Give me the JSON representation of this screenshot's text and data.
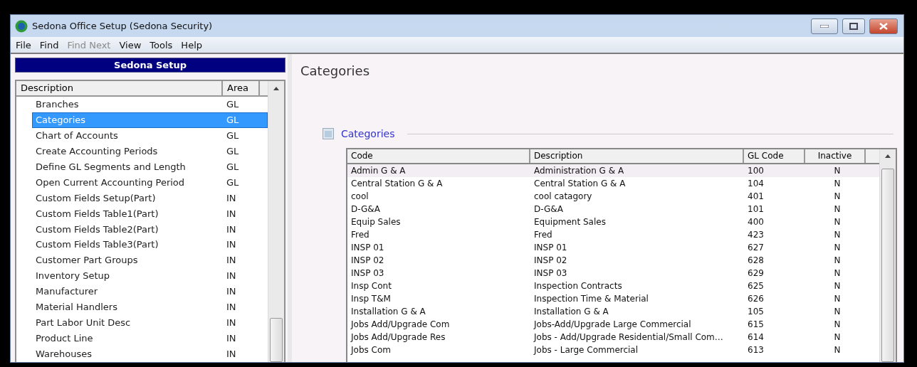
{
  "window": {
    "title": "Sedona Office Setup (Sedona Security)"
  },
  "menu": [
    {
      "label": "File",
      "disabled": false
    },
    {
      "label": "Find",
      "disabled": false
    },
    {
      "label": "Find Next",
      "disabled": true
    },
    {
      "label": "View",
      "disabled": false
    },
    {
      "label": "Tools",
      "disabled": false
    },
    {
      "label": "Help",
      "disabled": false
    }
  ],
  "sidebar": {
    "title": "Sedona Setup",
    "columns": [
      "Description",
      "Area"
    ],
    "items": [
      {
        "description": "Branches",
        "area": "GL",
        "selected": false
      },
      {
        "description": "Categories",
        "area": "GL",
        "selected": true
      },
      {
        "description": "Chart of Accounts",
        "area": "GL",
        "selected": false
      },
      {
        "description": "Create Accounting Periods",
        "area": "GL",
        "selected": false
      },
      {
        "description": "Define GL Segments and Length",
        "area": "GL",
        "selected": false
      },
      {
        "description": "Open Current Accounting Period",
        "area": "GL",
        "selected": false
      },
      {
        "description": "Custom Fields Setup(Part)",
        "area": "IN",
        "selected": false
      },
      {
        "description": "Custom Fields Table1(Part)",
        "area": "IN",
        "selected": false
      },
      {
        "description": "Custom Fields Table2(Part)",
        "area": "IN",
        "selected": false
      },
      {
        "description": "Custom Fields Table3(Part)",
        "area": "IN",
        "selected": false
      },
      {
        "description": "Customer Part Groups",
        "area": "IN",
        "selected": false
      },
      {
        "description": "Inventory Setup",
        "area": "IN",
        "selected": false
      },
      {
        "description": "Manufacturer",
        "area": "IN",
        "selected": false
      },
      {
        "description": "Material Handlers",
        "area": "IN",
        "selected": false
      },
      {
        "description": "Part Labor Unit Desc",
        "area": "IN",
        "selected": false
      },
      {
        "description": "Product Line",
        "area": "IN",
        "selected": false
      },
      {
        "description": "Warehouses",
        "area": "IN",
        "selected": false
      }
    ]
  },
  "content": {
    "title": "Categories",
    "group_title": "Categories",
    "table": {
      "columns": [
        "Code",
        "Description",
        "GL Code",
        "Inactive"
      ],
      "rows": [
        {
          "cells": [
            "Admin G & A",
            "Administration G & A",
            "100",
            "N"
          ],
          "selected": true
        },
        {
          "cells": [
            "Central Station G & A",
            "Central Station G & A",
            "104",
            "N"
          ],
          "selected": false
        },
        {
          "cells": [
            "cool",
            "cool catagory",
            "401",
            "N"
          ],
          "selected": false
        },
        {
          "cells": [
            "D-G&A",
            "D-G&A",
            "101",
            "N"
          ],
          "selected": false
        },
        {
          "cells": [
            "Equip Sales",
            "Equipment Sales",
            "400",
            "N"
          ],
          "selected": false
        },
        {
          "cells": [
            "Fred",
            "Fred",
            "423",
            "N"
          ],
          "selected": false
        },
        {
          "cells": [
            "INSP 01",
            "INSP 01",
            "627",
            "N"
          ],
          "selected": false
        },
        {
          "cells": [
            "INSP 02",
            "INSP 02",
            "628",
            "N"
          ],
          "selected": false
        },
        {
          "cells": [
            "INSP 03",
            "INSP 03",
            "629",
            "N"
          ],
          "selected": false
        },
        {
          "cells": [
            "Insp Cont",
            "Inspection Contracts",
            "625",
            "N"
          ],
          "selected": false
        },
        {
          "cells": [
            "Insp T&M",
            "Inspection Time & Material",
            "626",
            "N"
          ],
          "selected": false
        },
        {
          "cells": [
            "Installation G & A",
            "Installation G & A",
            "105",
            "N"
          ],
          "selected": false
        },
        {
          "cells": [
            "Jobs Add/Upgrade Com",
            "Jobs-Add/Upgrade Large Commercial",
            "615",
            "N"
          ],
          "selected": false
        },
        {
          "cells": [
            "Jobs Add/Upgrade Res",
            "Jobs - Add/Upgrade Residential/Small Com…",
            "614",
            "N"
          ],
          "selected": false
        },
        {
          "cells": [
            "Jobs Com",
            "Jobs - Large Commercial",
            "613",
            "N"
          ],
          "selected": false
        }
      ]
    }
  }
}
